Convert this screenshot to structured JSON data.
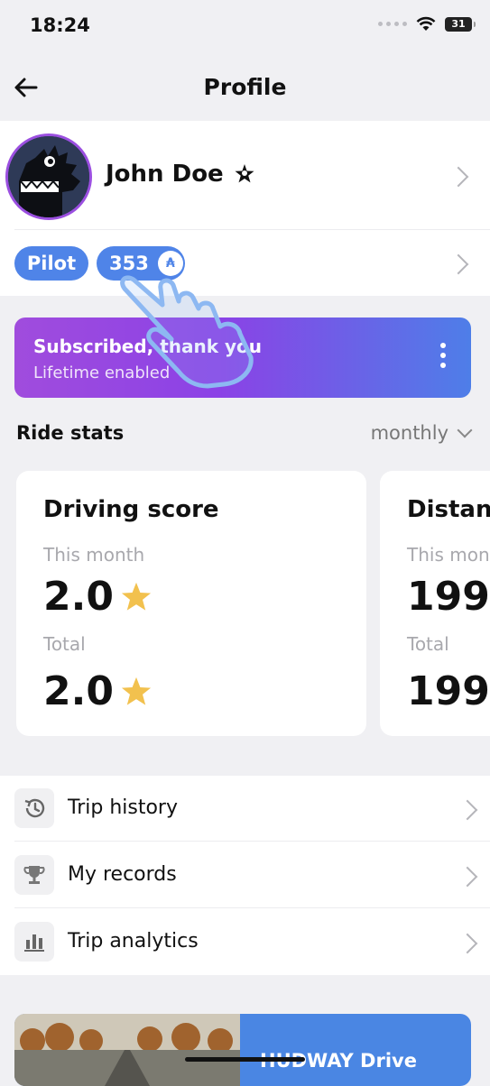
{
  "status": {
    "time": "18:24",
    "battery": "31"
  },
  "nav": {
    "title": "Profile"
  },
  "profile": {
    "name": "John Doe",
    "badge": "Pilot",
    "points": "353",
    "coin_symbol": "₳"
  },
  "subscription": {
    "title": "Subscribed, thank you",
    "subtitle": "Lifetime enabled"
  },
  "ride_stats": {
    "heading": "Ride stats",
    "period": "monthly",
    "cards": [
      {
        "title": "Driving score",
        "label_month": "This month",
        "value_month": "2.0",
        "label_total": "Total",
        "value_total": "2.0",
        "star": true
      },
      {
        "title": "Distance",
        "label_month": "This month",
        "value_month": "199",
        "label_total": "Total",
        "value_total": "199",
        "star": false
      }
    ]
  },
  "menu": [
    {
      "label": "Trip history",
      "icon": "history-icon"
    },
    {
      "label": "My records",
      "icon": "trophy-icon"
    },
    {
      "label": "Trip analytics",
      "icon": "bar-chart-icon"
    }
  ],
  "banner": {
    "text": "HUDWAY Drive"
  },
  "colors": {
    "accent": "#4f84e8",
    "purple": "#9b4fe0",
    "star": "#f2c14e"
  }
}
